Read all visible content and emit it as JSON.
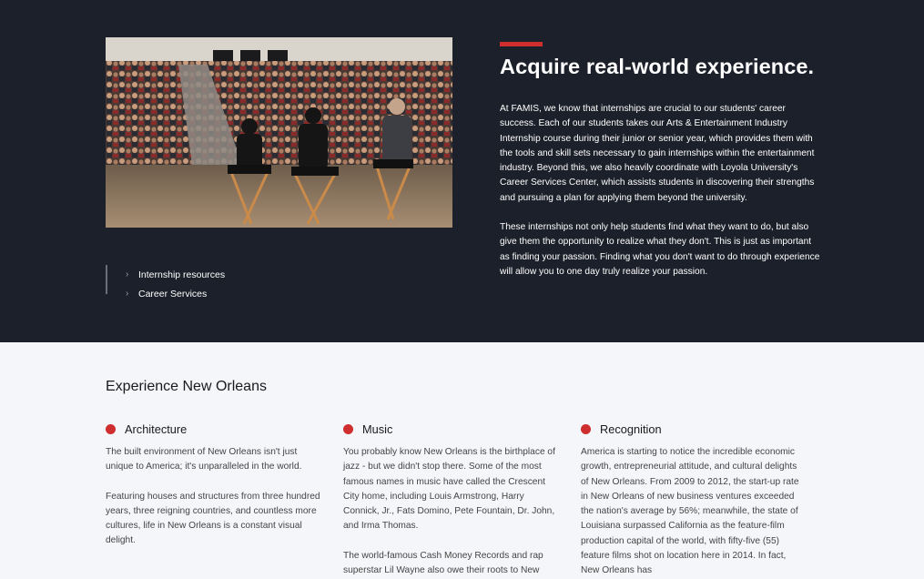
{
  "hero": {
    "headline": "Acquire real-world experience.",
    "paragraph_1": "At FAMIS, we know that internships are crucial to our students' career success. Each of our students takes our Arts & Entertainment Industry Internship course during their junior or senior year, which provides them with the tools and skill sets necessary to gain internships within the entertainment industry. Beyond this, we also heavily coordinate with Loyola University's Career Services Center, which assists students in discovering their strengths and pursuing a plan for applying them beyond the university.",
    "paragraph_2": "These internships not only help students find what they want to do, but also give them the opportunity to realize what they don't. This is just as important as finding your passion. Finding what you don't want to do through experience will allow you to one day truly realize your passion.",
    "links": [
      {
        "label": "Internship resources",
        "icon": "chevron-right-icon"
      },
      {
        "label": "Career Services",
        "icon": "chevron-right-icon"
      }
    ],
    "accent_color": "#cf2e2e"
  },
  "experience": {
    "title": "Experience New Orleans",
    "columns": [
      {
        "heading": "Architecture",
        "paragraphs": [
          "The built environment of New Orleans isn't just unique to America; it's unparalleled in the world.",
          "Featuring houses and structures from three hundred years, three reigning countries, and countless more cultures, life in New Orleans is a constant visual delight."
        ]
      },
      {
        "heading": "Music",
        "paragraphs": [
          "You probably know New Orleans is the birthplace of jazz - but we didn't stop there. Some of the most famous names in music have called the Crescent City home, including Louis Armstrong, Harry Connick, Jr., Fats Domino, Pete Fountain, Dr. John, and Irma Thomas.",
          "The world-famous Cash Money Records and rap superstar Lil Wayne also owe their roots to New"
        ]
      },
      {
        "heading": "Recognition",
        "paragraphs": [
          "America is starting to notice the incredible economic growth, entrepreneurial attitude, and cultural delights of New Orleans. From 2009 to 2012, the start-up rate in New Orleans of new business ventures exceeded the nation's average by 56%; meanwhile, the state of Louisiana surpassed California as the feature-film production capital of the world, with fifty-five (55) feature films shot on location here in 2014. In fact, New Orleans has"
        ]
      }
    ]
  }
}
